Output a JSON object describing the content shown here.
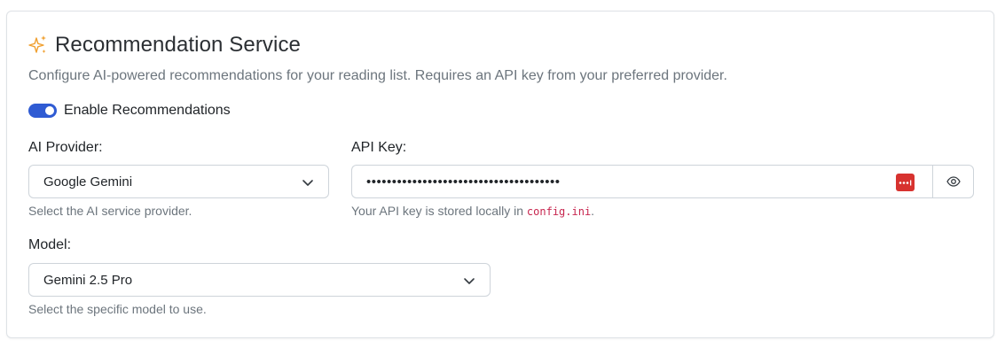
{
  "section": {
    "title": "Recommendation Service",
    "title_icon": "sparkles-icon",
    "description": "Configure AI-powered recommendations for your reading list. Requires an API key from your preferred provider.",
    "accent_color": "#2f5bd3",
    "icon_color": "#f0a030"
  },
  "toggle": {
    "label": "Enable Recommendations",
    "enabled": true
  },
  "provider": {
    "label": "AI Provider:",
    "value": "Google Gemini",
    "help": "Select the AI service provider."
  },
  "api_key": {
    "label": "API Key:",
    "masked_value": "••••••••••••••••••••••••••••••••••••••",
    "help_prefix": "Your API key is stored locally in ",
    "help_code": "config.ini",
    "help_suffix": ".",
    "password_manager_icon": "password-manager-icon",
    "reveal_icon": "eye-icon"
  },
  "model": {
    "label": "Model:",
    "value": "Gemini 2.5 Pro",
    "help": "Select the specific model to use."
  }
}
